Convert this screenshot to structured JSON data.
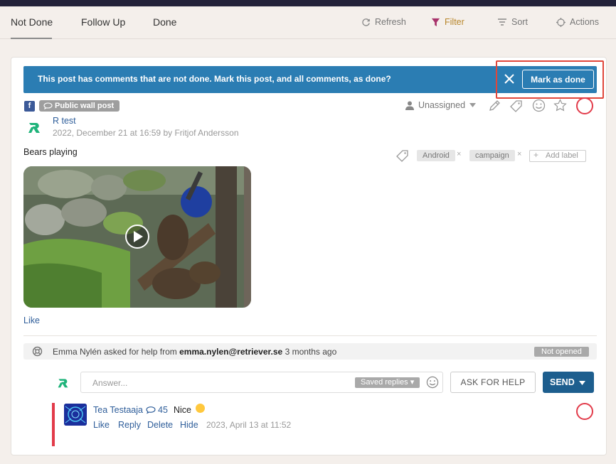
{
  "tabs": [
    {
      "label": "Not Done",
      "active": true
    },
    {
      "label": "Follow Up"
    },
    {
      "label": "Done"
    }
  ],
  "toolbar": {
    "refresh_label": "Refresh",
    "filter_label": "Filter",
    "sort_label": "Sort",
    "actions_label": "Actions"
  },
  "banner": {
    "message": "This post has comments that are not done. Mark this post, and all comments, as done?",
    "mark_done_label": "Mark as done"
  },
  "post": {
    "source_icon": "f",
    "tag": "Public wall post",
    "assignee": "Unassigned",
    "author": "R test",
    "meta": "2022, December 21 at 16:59 by Fritjof Andersson",
    "text": "Bears playing",
    "labels": [
      "Android",
      "campaign"
    ],
    "add_label": "Add label",
    "like_label": "Like"
  },
  "help_request": {
    "requester": "Emma Nylén",
    "middle": "asked for help from",
    "email": "emma.nylen@retriever.se",
    "when": "3 months ago",
    "status": "Not opened"
  },
  "reply_box": {
    "placeholder": "Answer...",
    "saved_replies": "Saved replies",
    "ask_for_help": "ASK FOR HELP",
    "send": "SEND"
  },
  "comment": {
    "author": "Tea Testaaja",
    "count": "45",
    "text": "Nice",
    "actions": [
      "Like",
      "Reply",
      "Delete",
      "Hide"
    ],
    "date": "2023, April 13 at 11:52"
  },
  "colors": {
    "banner": "#2b7db3",
    "accent_red": "#e23b4a",
    "link": "#2f5e9a",
    "filter": "#b8862b",
    "send": "#1d5e8e"
  }
}
